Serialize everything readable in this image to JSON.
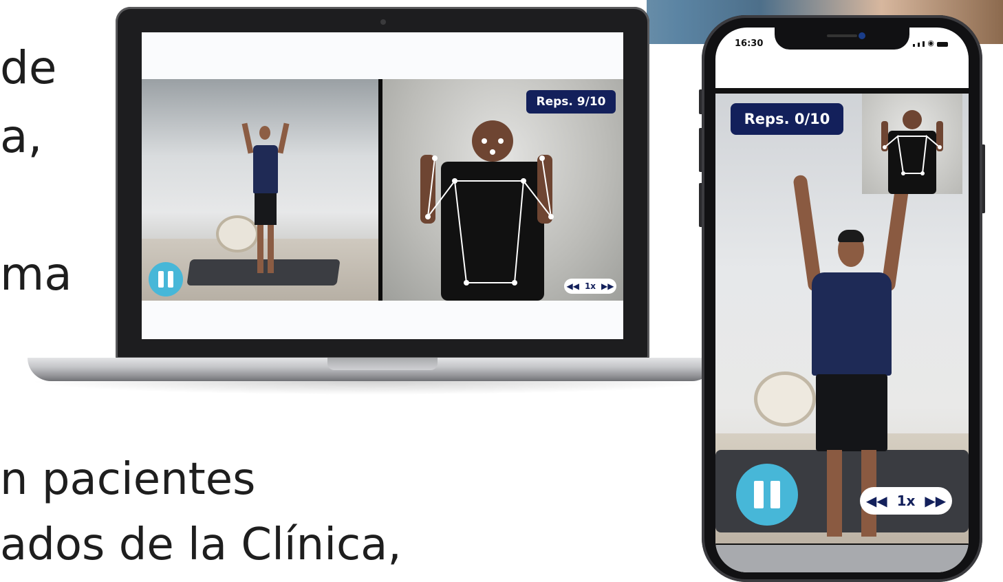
{
  "background_text": {
    "line1": "de",
    "line2": "a,",
    "line3": "ma",
    "line4": "n pacientes",
    "line5": "ados de la Clínica,"
  },
  "laptop": {
    "reps_label": "Reps. 9/10",
    "speed": {
      "rewind_icon": "rewind-icon",
      "label": "1x",
      "forward_icon": "fast-forward-icon"
    },
    "pause_icon": "pause-icon"
  },
  "phone": {
    "status_time": "16:30",
    "reps_label": "Reps. 0/10",
    "speed": {
      "rewind_icon": "rewind-icon",
      "label": "1x",
      "forward_icon": "fast-forward-icon"
    },
    "pause_icon": "pause-icon"
  },
  "colors": {
    "badge_bg": "#13205b",
    "pause_bg": "#47b7d8",
    "text": "#1e1e1e"
  }
}
